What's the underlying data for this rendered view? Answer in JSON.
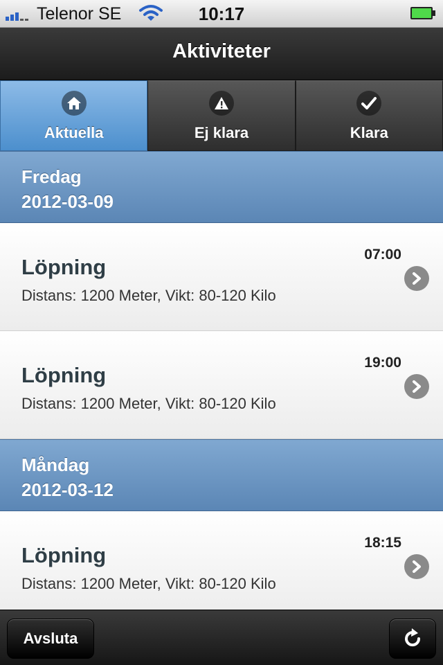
{
  "statusbar": {
    "carrier": "Telenor SE",
    "time": "10:17"
  },
  "header": {
    "title": "Aktiviteter"
  },
  "tabs": [
    {
      "label": "Aktuella",
      "icon": "home-icon",
      "active": true
    },
    {
      "label": "Ej klara",
      "icon": "warning-icon",
      "active": false
    },
    {
      "label": "Klara",
      "icon": "checkmark-icon",
      "active": false
    }
  ],
  "sections": [
    {
      "day": "Fredag",
      "date": "2012-03-09",
      "items": [
        {
          "name": "Löpning",
          "desc": "Distans: 1200 Meter, Vikt: 80-120 Kilo",
          "time": "07:00"
        },
        {
          "name": "Löpning",
          "desc": "Distans: 1200 Meter, Vikt: 80-120 Kilo",
          "time": "19:00"
        }
      ]
    },
    {
      "day": "Måndag",
      "date": "2012-03-12",
      "items": [
        {
          "name": "Löpning",
          "desc": "Distans: 1200 Meter, Vikt: 80-120 Kilo",
          "time": "18:15"
        }
      ]
    }
  ],
  "footer": {
    "exit_label": "Avsluta",
    "refresh_icon": "refresh-icon"
  },
  "colors": {
    "active_tab": "#5a9ad5",
    "divider": "#6c95c3",
    "header": "#2a2a2a"
  }
}
